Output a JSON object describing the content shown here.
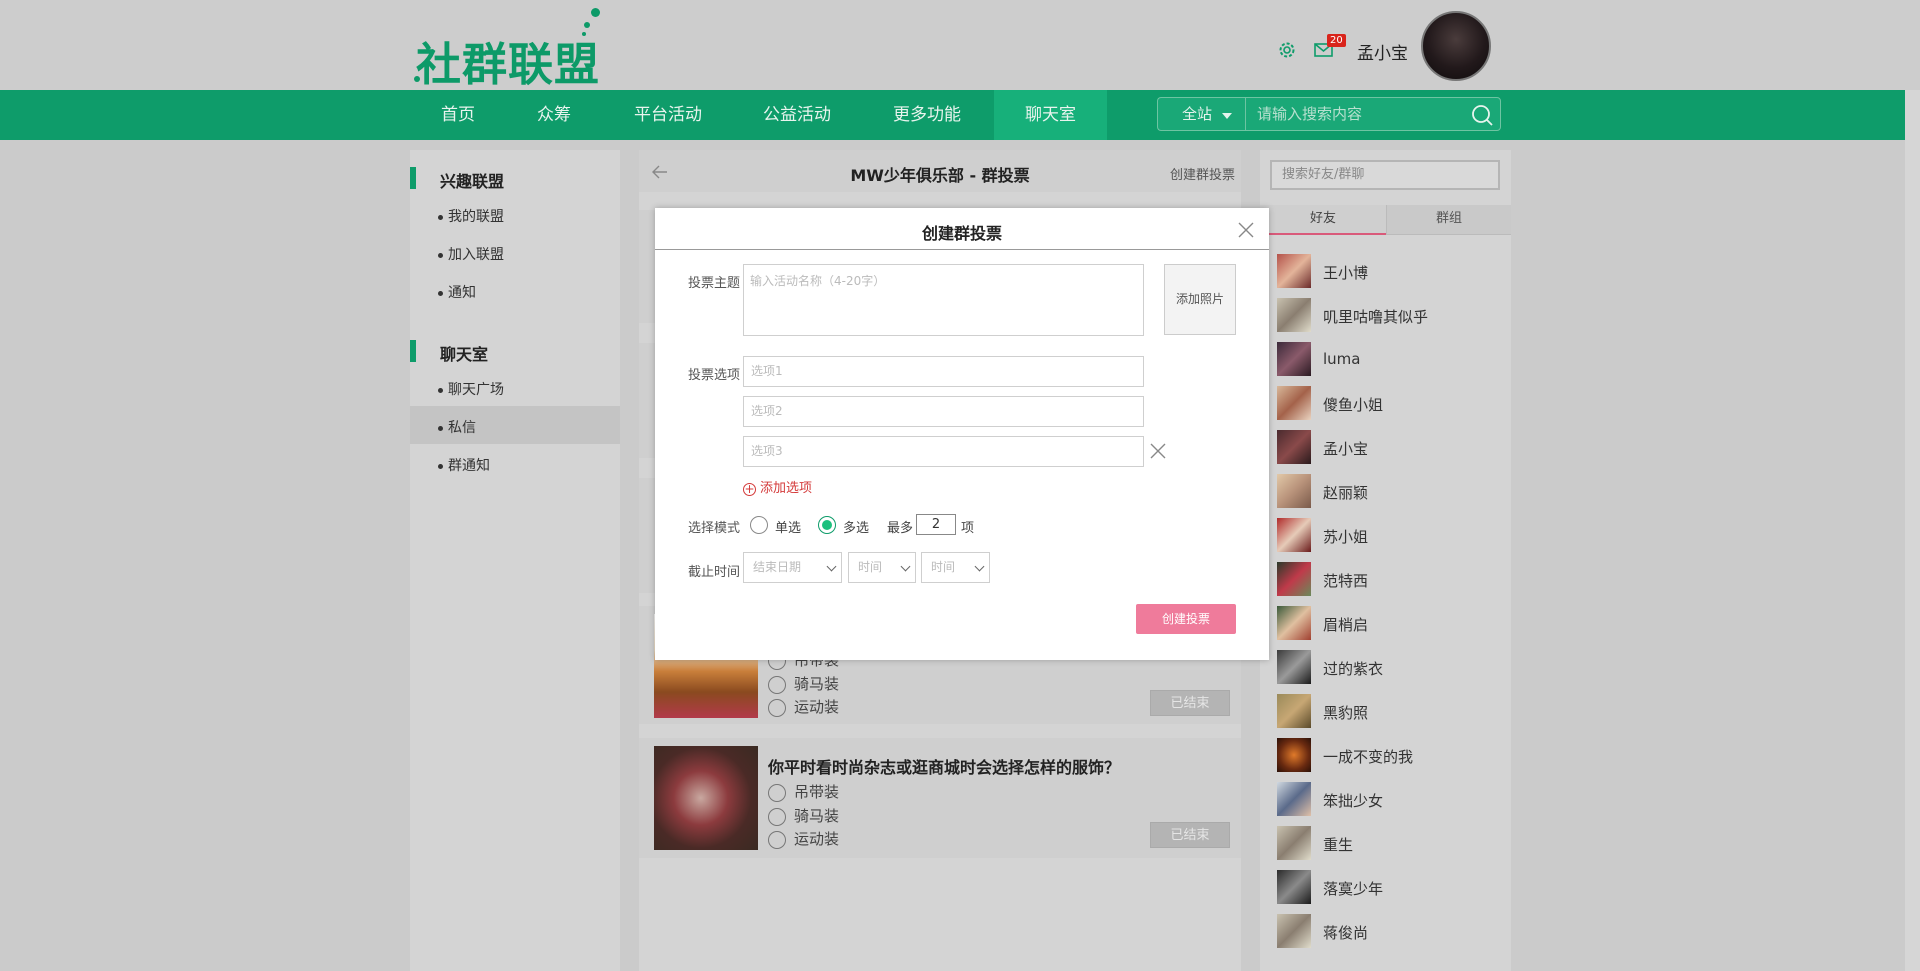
{
  "header": {
    "logo_text": "社群联盟",
    "notification_count": "20",
    "username": "孟小宝"
  },
  "nav": {
    "items": [
      "首页",
      "众筹",
      "平台活动",
      "公益活动",
      "更多功能",
      "聊天室"
    ],
    "active": "聊天室",
    "search_scope": "全站",
    "search_placeholder": "请输入搜索内容"
  },
  "left_sidebar": {
    "sections": [
      {
        "title": "兴趣联盟",
        "items": [
          "我的联盟",
          "加入联盟",
          "通知"
        ]
      },
      {
        "title": "聊天室",
        "items": [
          "聊天广场",
          "私信",
          "群通知"
        ]
      }
    ],
    "selected": "私信"
  },
  "center": {
    "title": "MW少年俱乐部 - 群投票",
    "create_link": "创建群投票",
    "polls": [
      {
        "question": "",
        "options": [
          "吊带装",
          "骑马装",
          "运动装"
        ],
        "status": "已结束"
      },
      {
        "question": "你平时看时尚杂志或逛商城时会选择怎样的服饰？",
        "options": [
          "吊带装",
          "骑马装",
          "运动装"
        ],
        "status": "已结束"
      }
    ]
  },
  "right_sidebar": {
    "search_placeholder": "搜索好友/群聊",
    "tabs": [
      "好友",
      "群组"
    ],
    "active_tab": "好友",
    "friends": [
      "王小博",
      "叽里咕噜其似乎",
      "luma",
      "傻鱼小姐",
      "孟小宝",
      "赵丽颖",
      "苏小姐",
      "范特西",
      "眉梢启",
      "过的紫衣",
      "黑豹照",
      "一成不变的我",
      "笨拙少女",
      "重生",
      "落寞少年",
      "蒋俊尚"
    ]
  },
  "modal": {
    "title": "创建群投票",
    "topic_label": "投票主题",
    "topic_placeholder": "输入活动名称（4-20字）",
    "add_photo": "添加照片",
    "options_label": "投票选项",
    "option_placeholders": [
      "选项1",
      "选项2",
      "选项3"
    ],
    "add_option": "添加选项",
    "mode_label": "选择模式",
    "mode_single": "单选",
    "mode_multi": "多选",
    "selected_mode": "多选",
    "max_prefix": "最多",
    "max_value": "2",
    "max_suffix": "项",
    "deadline_label": "截止时间",
    "date_placeholder": "结束日期",
    "time_placeholder_1": "时间",
    "time_placeholder_2": "时间",
    "submit": "创建投票"
  },
  "colors": {
    "brand_green": "#0e9c6a",
    "pink_button": "#ef7b9b",
    "add_option_red": "#d43a3a"
  }
}
